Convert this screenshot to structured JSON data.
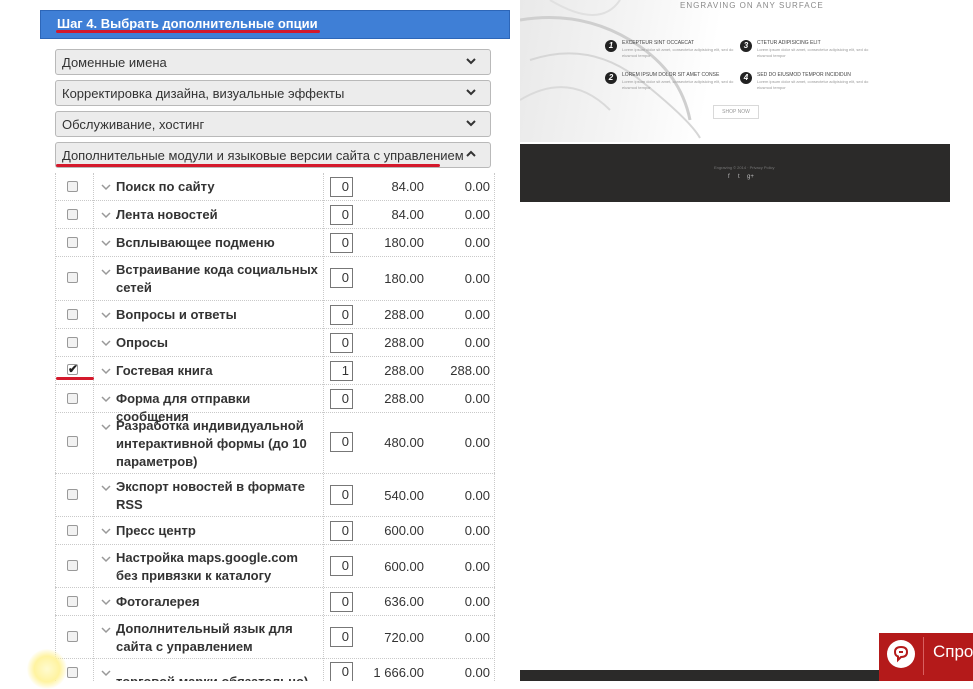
{
  "step": {
    "title": "Шаг 4. Выбрать дополнительные опции"
  },
  "accordion": [
    {
      "label": "Доменные имена",
      "state": "collapsed"
    },
    {
      "label": "Корректировка дизайна, визуальные эффекты",
      "state": "collapsed"
    },
    {
      "label": "Обслуживание, хостинг",
      "state": "collapsed"
    },
    {
      "label": "Дополнительные модули и языковые версии сайта с управлением",
      "state": "expanded"
    }
  ],
  "options": [
    {
      "name": "Поиск по сайту",
      "qty": "0",
      "price": "84.00",
      "total": "0.00",
      "checked": false
    },
    {
      "name": "Лента новостей",
      "qty": "0",
      "price": "84.00",
      "total": "0.00",
      "checked": false
    },
    {
      "name": "Всплывающее подменю",
      "qty": "0",
      "price": "180.00",
      "total": "0.00",
      "checked": false
    },
    {
      "name": "Встраивание кода социальных сетей",
      "qty": "0",
      "price": "180.00",
      "total": "0.00",
      "checked": false
    },
    {
      "name": "Вопросы и ответы",
      "qty": "0",
      "price": "288.00",
      "total": "0.00",
      "checked": false
    },
    {
      "name": "Опросы",
      "qty": "0",
      "price": "288.00",
      "total": "0.00",
      "checked": false
    },
    {
      "name": "Гостевая книга",
      "qty": "1",
      "price": "288.00",
      "total": "288.00",
      "checked": true
    },
    {
      "name": "Форма для отправки сообщения",
      "qty": "0",
      "price": "288.00",
      "total": "0.00",
      "checked": false
    },
    {
      "name": "Разработка индивидуальной интерактивной формы (до 10 параметров)",
      "qty": "0",
      "price": "480.00",
      "total": "0.00",
      "checked": false
    },
    {
      "name": "Экспорт новостей в формате RSS",
      "qty": "0",
      "price": "540.00",
      "total": "0.00",
      "checked": false
    },
    {
      "name": "Пресс центр",
      "qty": "0",
      "price": "600.00",
      "total": "0.00",
      "checked": false
    },
    {
      "name": "Настройка maps.google.com без привязки к каталогу",
      "qty": "0",
      "price": "600.00",
      "total": "0.00",
      "checked": false
    },
    {
      "name": "Фотогалерея",
      "qty": "0",
      "price": "636.00",
      "total": "0.00",
      "checked": false
    },
    {
      "name": "Дополнительный язык для сайта с управлением",
      "qty": "0",
      "price": "720.00",
      "total": "0.00",
      "checked": false
    },
    {
      "name": "торговой марки обязательно)",
      "qty": "0",
      "price": "1 666.00",
      "total": "0.00",
      "checked": false
    }
  ],
  "preview": {
    "hero_title": "ENGRAVING ON ANY SURFACE",
    "features": [
      {
        "num": "1",
        "title": "EXCEPTEUR SINT OCCAECAT",
        "desc": "Lorem ipsum dolor sit amet, consectetur adipisicing elit, sed do eiusmod tempor"
      },
      {
        "num": "2",
        "title": "LOREM IPSUM DOLOR SIT AMET CONSE",
        "desc": "Lorem ipsum dolor sit amet, consectetur adipisicing elit, sed do eiusmod tempor"
      },
      {
        "num": "3",
        "title": "CTETUR ADIPISICING ELIT",
        "desc": "Lorem ipsum dolor sit amet, consectetur adipisicing elit, sed do eiusmod tempor"
      },
      {
        "num": "4",
        "title": "SED DO EIUSMOD TEMPOR INCIDIDUN",
        "desc": "Lorem ipsum dolor sit amet, consectetur adipisicing elit, sed do eiusmod tempor"
      }
    ],
    "shop_button": "SHOP NOW",
    "footer_text": "Engraving © 2014 · Privacy Policy",
    "social": [
      "f",
      "t",
      "g+"
    ]
  },
  "chat": {
    "label": "Спро"
  },
  "colors": {
    "header": "#3f7fd6",
    "annotation": "#d4192c",
    "chat": "#b41a1a",
    "footer": "#2b2a29"
  }
}
